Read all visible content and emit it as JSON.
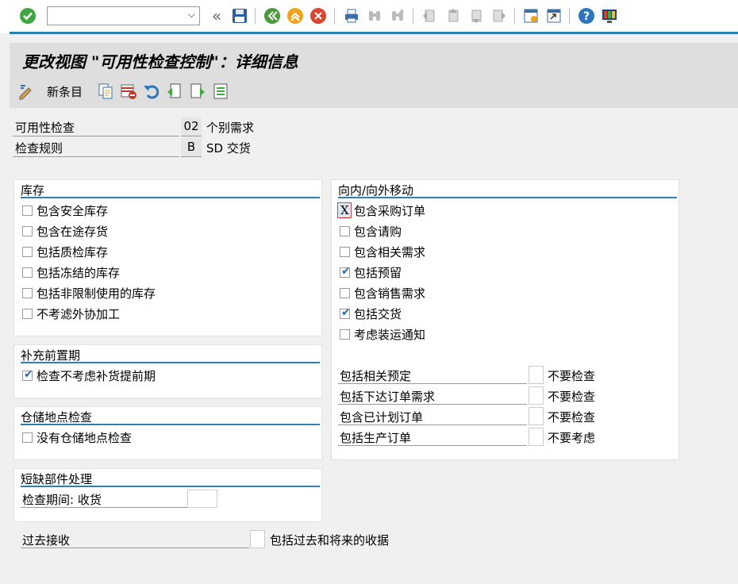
{
  "toolbar": {
    "command_field_value": "",
    "icons": [
      "enter-icon",
      "history-dropdown-icon",
      "double-left-icon",
      "save-icon",
      "back-icon",
      "exit-icon",
      "cancel-icon",
      "print-icon",
      "find-icon",
      "find-next-icon",
      "first-page-icon",
      "previous-page-icon",
      "next-page-icon",
      "last-page-icon",
      "new-session-icon",
      "shortcut-icon",
      "help-icon",
      "layout-icon"
    ]
  },
  "page": {
    "title": "更改视图 \"可用性检查控制\"：详细信息"
  },
  "appbar": {
    "new_entries_label": "新条目"
  },
  "header": {
    "availability_check_label": "可用性检查",
    "availability_check_code": "02",
    "availability_check_text": "个别需求",
    "check_rule_label": "检查规则",
    "check_rule_code": "B",
    "check_rule_text": "SD 交货"
  },
  "stock": {
    "title": "库存",
    "items": [
      {
        "label": "包含安全库存",
        "checked": false
      },
      {
        "label": "包含在途存货",
        "checked": false
      },
      {
        "label": "包括质检库存",
        "checked": false
      },
      {
        "label": "包括冻结的库存",
        "checked": false
      },
      {
        "label": "包括非限制使用的库存",
        "checked": false
      },
      {
        "label": "不考滤外协加工",
        "checked": false
      }
    ]
  },
  "replenishment": {
    "title": "补充前置期",
    "items": [
      {
        "label": "检查不考虑补货提前期",
        "checked": true
      }
    ]
  },
  "storage": {
    "title": "仓储地点检查",
    "items": [
      {
        "label": "没有仓储地点检查",
        "checked": false
      }
    ]
  },
  "shortage": {
    "title": "短缺部件处理",
    "period_label": "检查期间: 收货",
    "period_value": ""
  },
  "past": {
    "label": "过去接收",
    "value": "",
    "text": "包括过去和将来的收据"
  },
  "movements": {
    "title": "向内/向外移动",
    "items": [
      {
        "label": "包含采购订单",
        "checked": true,
        "mark": "X"
      },
      {
        "label": "包含请购",
        "checked": false
      },
      {
        "label": "包含相关需求",
        "checked": false
      },
      {
        "label": "包括预留",
        "checked": true
      },
      {
        "label": "包含销售需求",
        "checked": false
      },
      {
        "label": "包括交货",
        "checked": true
      },
      {
        "label": "考虑装运通知",
        "checked": false
      }
    ],
    "fields": [
      {
        "label": "包括相关预定",
        "value": "",
        "text": "不要检查"
      },
      {
        "label": "包括下达订单需求",
        "value": "",
        "text": "不要检查"
      },
      {
        "label": "包含已计划订单",
        "value": "",
        "text": "不要检查"
      },
      {
        "label": "包括生产订单",
        "value": "",
        "text": "不要考虑"
      }
    ]
  }
}
